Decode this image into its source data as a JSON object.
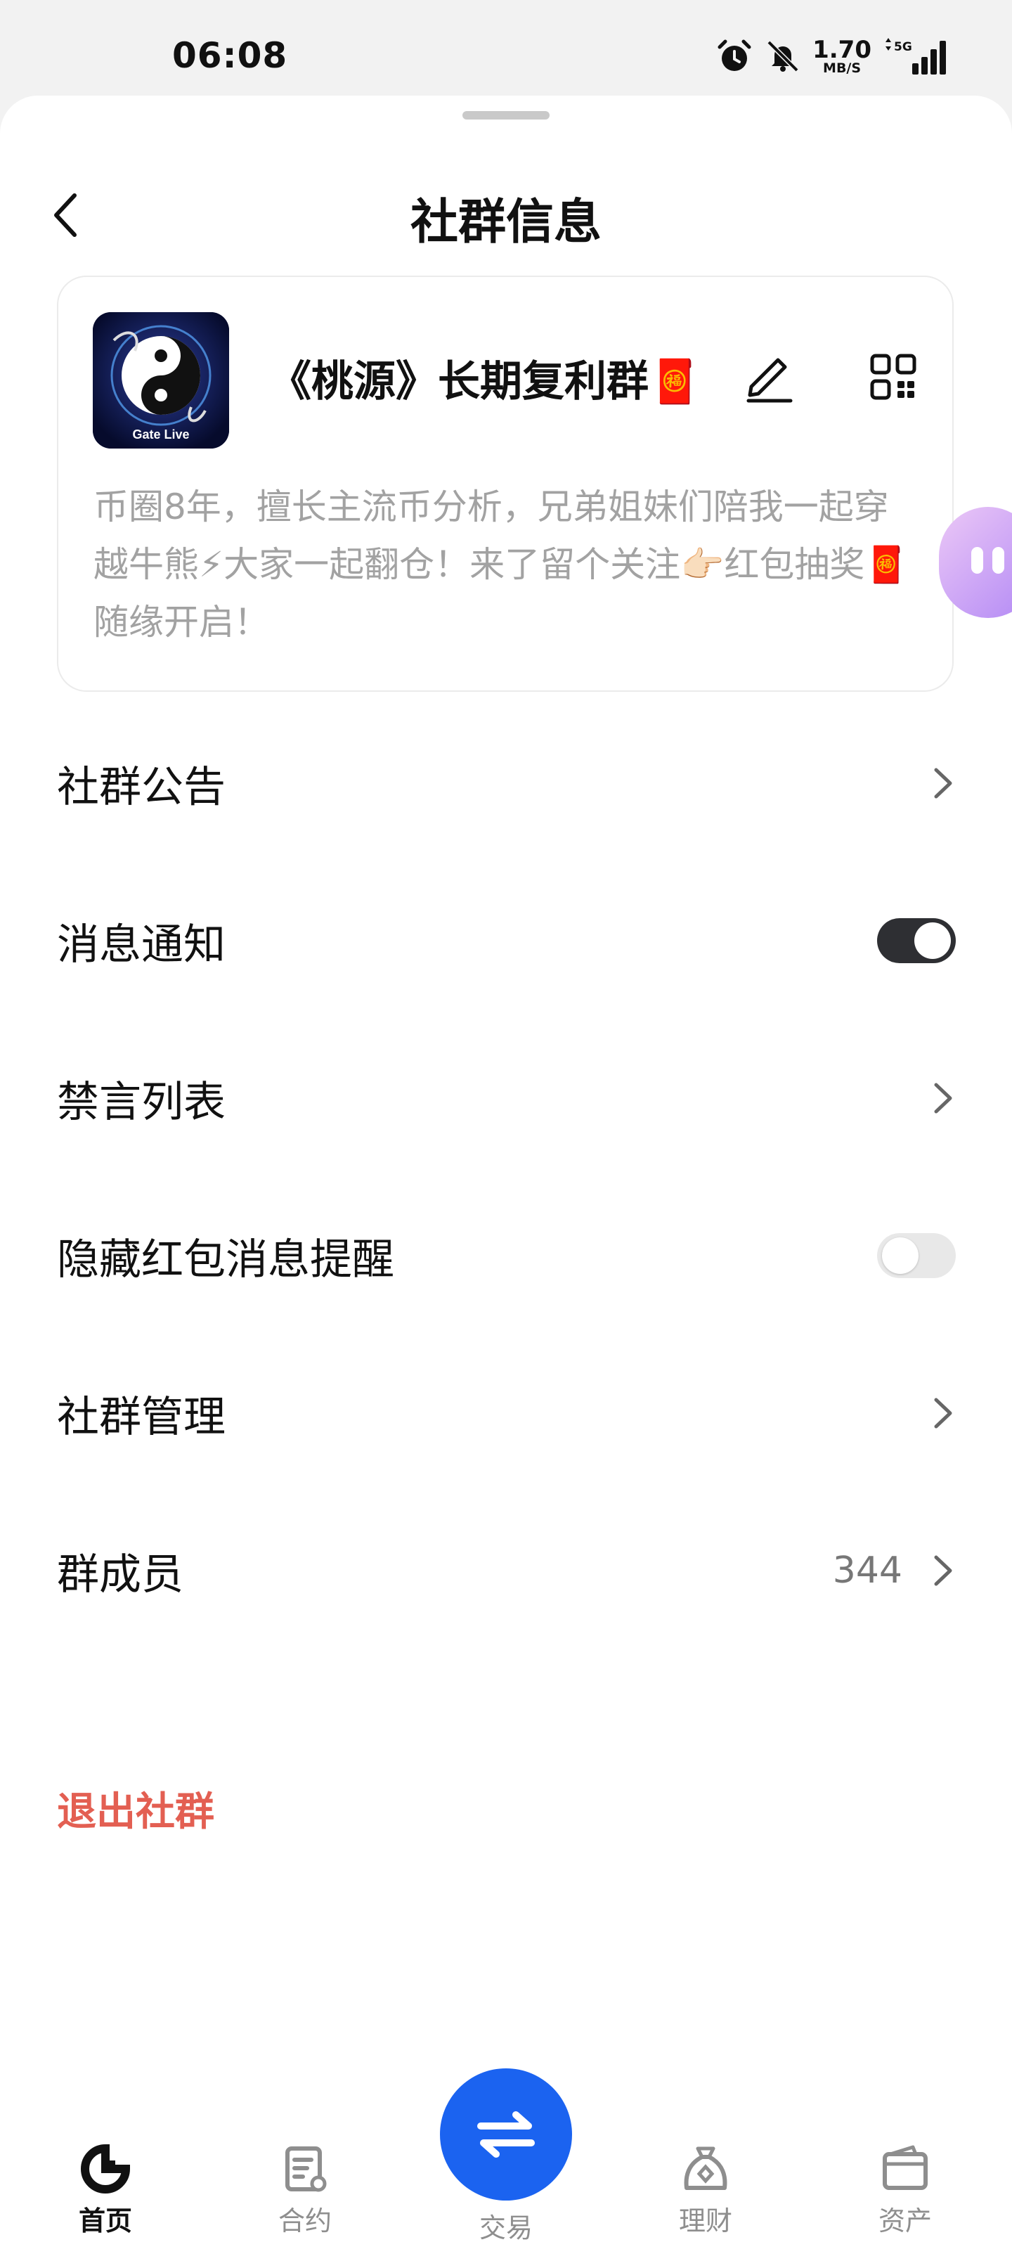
{
  "status_bar": {
    "time": "06:08",
    "net_speed_value": "1.70",
    "net_speed_unit": "MB/S",
    "signal_label": "5G",
    "icons": [
      "alarm-icon",
      "muted-bell-icon",
      "data-arrows-icon",
      "signal-icon"
    ]
  },
  "header": {
    "title": "社群信息",
    "back_icon": "chevron-left-icon"
  },
  "group": {
    "avatar_text": "Gate Live",
    "name": "《桃源》长期复利群",
    "name_emoji": "🧧",
    "description": "币圈8年，擅长主流币分析，兄弟姐妹们陪我一起穿越牛熊⚡大家一起翻仓！来了留个关注👉🏻红包抽奖🧧随缘开启！",
    "edit_icon": "pencil-icon",
    "qr_icon": "qr-code-icon"
  },
  "menu": {
    "announcement": {
      "label": "社群公告"
    },
    "notifications": {
      "label": "消息通知",
      "enabled": true
    },
    "mute_list": {
      "label": "禁言列表"
    },
    "hide_red_packet": {
      "label": "隐藏红包消息提醒",
      "enabled": false
    },
    "management": {
      "label": "社群管理"
    },
    "members": {
      "label": "群成员",
      "count": "344"
    },
    "exit": {
      "label": "退出社群"
    }
  },
  "tabbar": {
    "tabs": [
      {
        "label": "首页",
        "icon": "home-logo-icon",
        "active": true
      },
      {
        "label": "合约",
        "icon": "contract-icon",
        "active": false
      },
      {
        "label": "交易",
        "icon": "swap-arrows-icon",
        "active": false
      },
      {
        "label": "理财",
        "icon": "money-bag-icon",
        "active": false
      },
      {
        "label": "资产",
        "icon": "wallet-icon",
        "active": false
      }
    ]
  },
  "colors": {
    "accent": "#1b63f0",
    "danger": "#e35f52",
    "toggle_on": "#2e2f33"
  }
}
